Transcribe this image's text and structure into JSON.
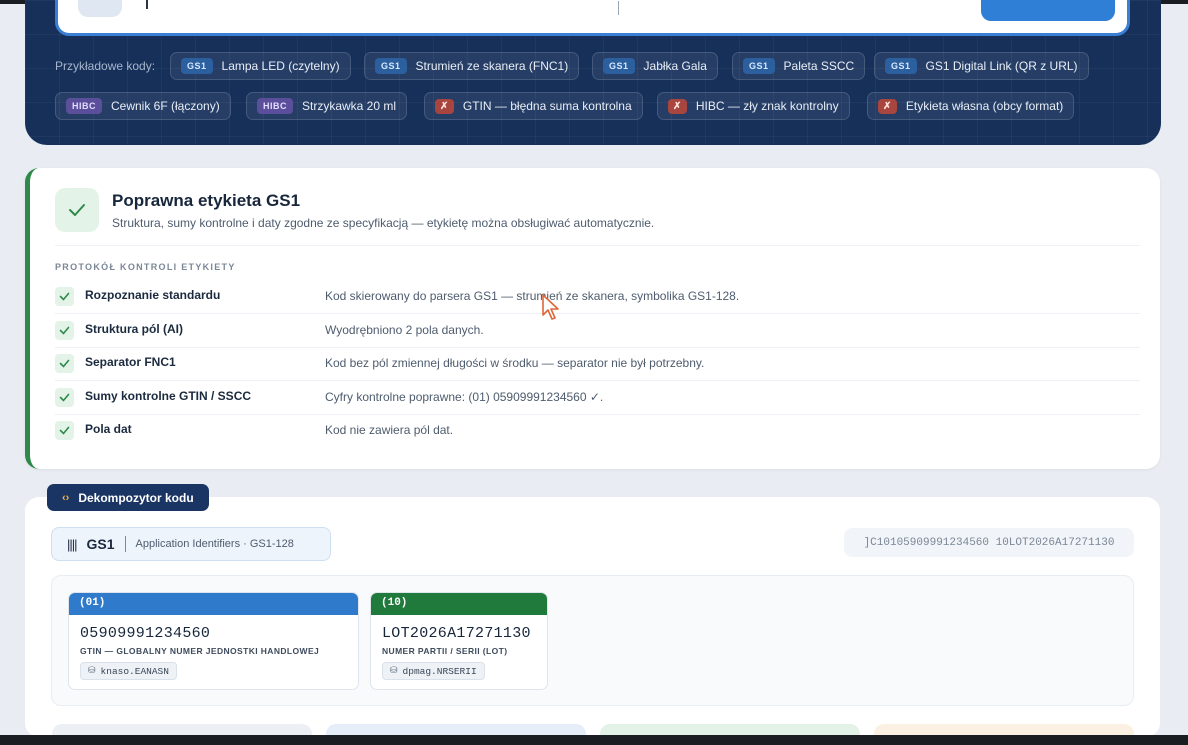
{
  "hero": {
    "examples_label": "Przykładowe kody:",
    "chips_row1": [
      {
        "tag": "GS1",
        "label": "Lampa LED (czytelny)",
        "kind": "gs1"
      },
      {
        "tag": "GS1",
        "label": "Strumień ze skanera (FNC1)",
        "kind": "gs1"
      },
      {
        "tag": "GS1",
        "label": "Jabłka Gala",
        "kind": "gs1"
      },
      {
        "tag": "GS1",
        "label": "Paleta SSCC",
        "kind": "gs1"
      },
      {
        "tag": "GS1",
        "label": "GS1 Digital Link (QR z URL)",
        "kind": "gs1"
      }
    ],
    "chips_row2": [
      {
        "tag": "HIBC",
        "label": "Cewnik 6F (łączony)",
        "kind": "hibc"
      },
      {
        "tag": "HIBC",
        "label": "Strzykawka 20 ml",
        "kind": "hibc"
      },
      {
        "tag": "✗",
        "label": "GTIN — błędna suma kontrolna",
        "kind": "err"
      },
      {
        "tag": "✗",
        "label": "HIBC — zły znak kontrolny",
        "kind": "err"
      },
      {
        "tag": "✗",
        "label": "Etykieta własna (obcy format)",
        "kind": "err"
      }
    ]
  },
  "result": {
    "title": "Poprawna etykieta GS1",
    "subtitle": "Struktura, sumy kontrolne i daty zgodne ze specyfikacją — etykietę można obsługiwać automatycznie.",
    "protocol_heading": "PROTOKÓŁ KONTROLI ETYKIETY",
    "checks": [
      {
        "name": "Rozpoznanie standardu",
        "desc": "Kod skierowany do parsera GS1 — strumień ze skanera, symbolika GS1-128."
      },
      {
        "name": "Struktura pól (AI)",
        "desc": "Wyodrębniono 2 pola danych."
      },
      {
        "name": "Separator FNC1",
        "desc": "Kod bez pól zmiennej długości w środku — separator nie był potrzebny."
      },
      {
        "name": "Sumy kontrolne GTIN / SSCC",
        "desc": "Cyfry kontrolne poprawne: (01) 05909991234560 ✓."
      },
      {
        "name": "Pola dat",
        "desc": "Kod nie zawiera pól dat."
      }
    ]
  },
  "decomposer": {
    "tab_label": "Dekompozytor kodu",
    "standard": "GS1",
    "standard_desc": "Application Identifiers · GS1-128",
    "raw_code": "]C10105909991234560 10LOT2026A17271130",
    "fields": [
      {
        "ai": "(01)",
        "value": "05909991234560",
        "label": "GTIN — GLOBALNY NUMER JEDNOSTKI HANDLOWEJ",
        "db_field": "knaso.EANASN",
        "color": "#2f7acb"
      },
      {
        "ai": "(10)",
        "value": "LOT2026A17271130",
        "label": "NUMER PARTII / SERII (LOT)",
        "db_field": "dpmag.NRSERII",
        "color": "#1f7a3c"
      }
    ]
  },
  "colors": {
    "accent": "#2f7fd6",
    "success": "#2e8a4a",
    "hero_bg": "#16305a"
  }
}
